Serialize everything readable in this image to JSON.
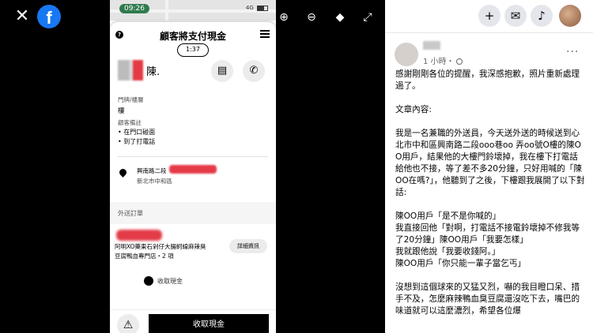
{
  "viewer": {
    "close_icon": "close-icon",
    "logo_letter": "f"
  },
  "phone": {
    "status_time": "09:26",
    "status_signal": "4G",
    "title": "顧客將支付現金",
    "timer": "1:37",
    "customer_name": "陳.",
    "door_label": "門牌/樓層",
    "door_value": "樓",
    "note_label": "顧客備註",
    "note_items": [
      "• 在門口碰面",
      "• 到了打電話"
    ],
    "addr_line1": "興南路二段",
    "addr_line2": "新北市中和區",
    "section_label": "外送訂單",
    "order_line1": "阿明XO藥東石剁仔大腸蚵線麻辣臭",
    "order_line2": "豆腐鴨血專門店・2 項",
    "detail_button": "詳細資訊",
    "cash_label": "收取現金",
    "collect_button": "收取現金",
    "warn_icon": "⚠"
  },
  "toolbar": {
    "zoom_in": "zoom-in-icon",
    "zoom_out": "zoom-out-icon",
    "tag": "tag-icon",
    "expand": "expand-icon"
  },
  "post": {
    "time": "1 小時・",
    "more": "···",
    "text": "感謝剛剛各位的提醒，我深感抱歉，照片重新處理過了。\n\n文章內容:\n\n我是一名兼職的外送員，今天送外送的時候送到心北市中和區興南路二段ooo巷oo 弄oo號O樓的陳OO用戶，結果他的大樓門鈴壞掉，我在樓下打電話給他也不接，等了差不多20分鐘，只好用喊的「陳OO在嗎?」，他聽到了之後，下樓跟我展開了以下對話:\n\n陳OO用戶「是不是你喊的」\n我直接回他「對啊，打電話不接電鈴壞掉不修我等了20分鐘」陳OO用戶「我要怎樣」\n我就跟他說「我要收錢阿。」\n陳OO用戶「你只能一輩子當乞丐」\n\n沒想到這個球來的又猛又烈，嚇的我目瞪口呆、措手不及，怎麼麻辣鴨血臭豆腐還沒吃下去，嘴巴的味道就可以這麼濃烈，希望各位爆"
  }
}
